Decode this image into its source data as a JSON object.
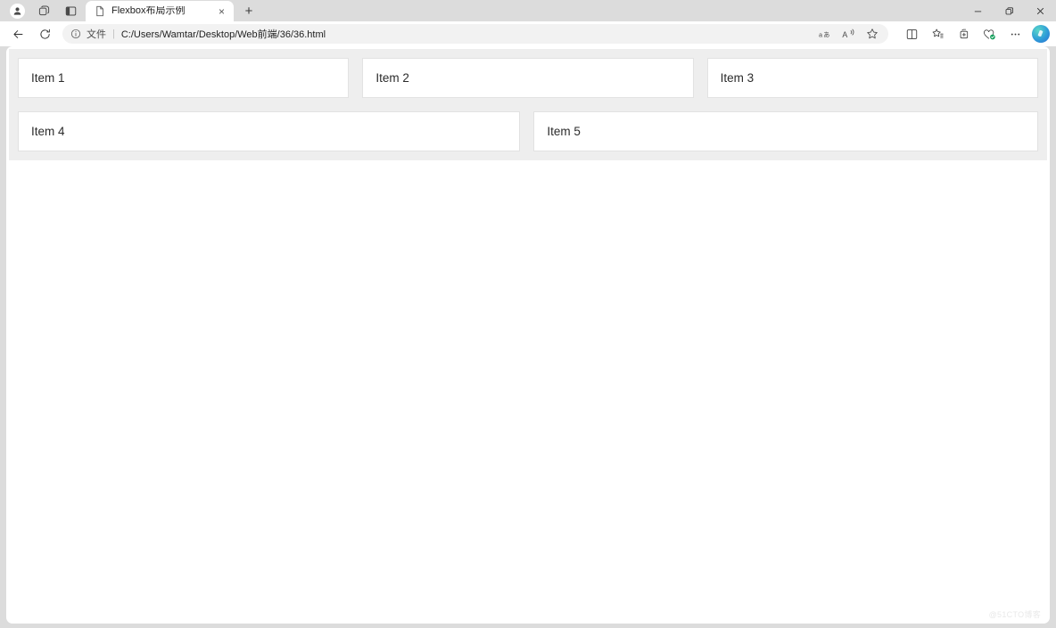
{
  "browser": {
    "left_icons": [
      {
        "name": "profile-avatar",
        "label": "Profile"
      },
      {
        "name": "workspaces-icon",
        "label": "Workspaces"
      },
      {
        "name": "tab-actions-icon",
        "label": "Tab actions menu"
      }
    ],
    "tab": {
      "title": "Flexbox布局示例",
      "favicon": "document-icon",
      "close_label": "×"
    },
    "new_tab_label": "+",
    "window_controls": {
      "minimize": "—",
      "restore": "❐",
      "close": "✕"
    },
    "nav": {
      "back_label": "Back",
      "refresh_label": "Refresh"
    },
    "address_bar": {
      "info_icon": "info-icon",
      "scheme_label": "文件",
      "separator": "|",
      "url": "C:/Users/Wamtar/Desktop/Web前端/36/36.html",
      "actions": [
        {
          "name": "translate-icon",
          "label": "aあ"
        },
        {
          "name": "read-aloud-icon",
          "label": "A"
        },
        {
          "name": "add-favorite-icon",
          "label": "Add to favorites"
        }
      ]
    },
    "toolbar_right": [
      {
        "name": "split-screen-icon",
        "label": "Split screen"
      },
      {
        "name": "favorites-icon",
        "label": "Favorites"
      },
      {
        "name": "collections-icon",
        "label": "Collections"
      },
      {
        "name": "browser-essentials-icon",
        "label": "Browser essentials"
      },
      {
        "name": "settings-more-icon",
        "label": "⋯"
      },
      {
        "name": "copilot-icon",
        "label": "Copilot"
      }
    ]
  },
  "page": {
    "items": [
      {
        "label": "Item 1"
      },
      {
        "label": "Item 2"
      },
      {
        "label": "Item 3"
      },
      {
        "label": "Item 4"
      },
      {
        "label": "Item 5"
      }
    ],
    "watermark": "@51CTO博客"
  },
  "colors": {
    "chrome_bg": "#dcdcdc",
    "tab_active_bg": "#ffffff",
    "omnibox_bg": "#f2f2f2",
    "container_bg": "#eeeeee",
    "item_bg": "#ffffff",
    "item_border": "#e2e2e2",
    "text": "#2b2b2b"
  }
}
